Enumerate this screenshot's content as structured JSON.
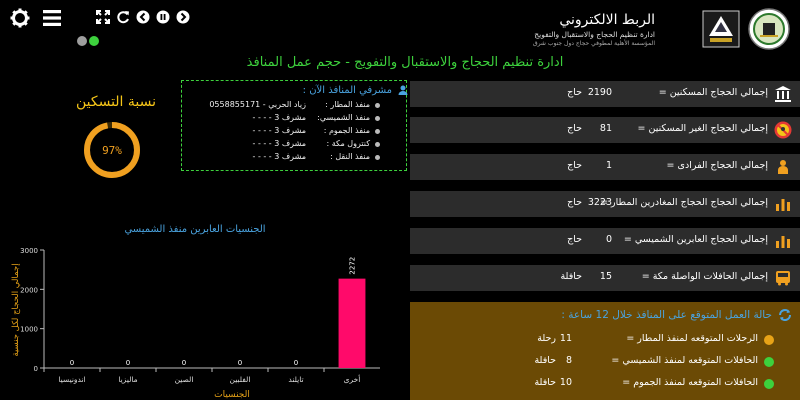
{
  "brand": {
    "title": "الربط الالكتروني",
    "subtitle": "ادارة تنظيم الحجاج والاستقبال والتفويج",
    "subtitle2": "المؤسسة الأهلية لمطوفي حجاج دول جنوب شرق"
  },
  "page_title": "ادارة تنظيم الحجاج والاستقبال والتفويج - حجم عمل المنافذ",
  "toolbar": {
    "icons": [
      "gear-icon",
      "menu-icon",
      "fullscreen-icon",
      "refresh-icon",
      "back-icon",
      "pause-icon",
      "forward-icon"
    ]
  },
  "status_dots": {
    "colors": [
      "#9e9e9e",
      "#3dd13d"
    ]
  },
  "occupancy": {
    "title": "نسبة التسكين",
    "value": "97%",
    "percent": 97,
    "color": "#f0a020"
  },
  "supervisors": {
    "title": "مشرفي المنافذ الآن :",
    "rows": [
      {
        "key": "منفذ المطار :",
        "value": "زياد الحربي - 0558855171"
      },
      {
        "key": "منفذ الشميسي:",
        "value": "مشرف 3 - - - -"
      },
      {
        "key": "منفذ الجموم :",
        "value": "مشرف 3 - - - -"
      },
      {
        "key": "كنترول مكة :",
        "value": "مشرف 3 - - - -"
      },
      {
        "key": "منفذ النقل :",
        "value": "مشرف 3 - - - -"
      }
    ]
  },
  "stats": [
    {
      "icon": "bank-icon",
      "label": "إجمالي الحجاج المسكنين =",
      "value": "2190",
      "unit": "حاج"
    },
    {
      "icon": "no-entry-icon",
      "label": "إجمالي الحجاج الغير المسكنين =",
      "value": "81",
      "unit": "حاج"
    },
    {
      "icon": "person-icon",
      "label": "إجمالي الحجاج الفرادى =",
      "value": "1",
      "unit": "حاج"
    },
    {
      "icon": "bar-chart-icon",
      "label": "إجمالي الحجاج الحجاج المغادرين المطار =",
      "value": "3223",
      "unit": "حاج"
    },
    {
      "icon": "bar-chart-icon",
      "label": "إجمالي الحجاج العابرين الشميسي =",
      "value": "0",
      "unit": "حاج"
    },
    {
      "icon": "bar-chart-icon",
      "label": "إجمالي الحافلات الواصلة مكة =",
      "value": "15",
      "unit": "حافلة"
    }
  ],
  "expected": {
    "title": "حالة العمل المتوقع على المنافذ خلال 12 ساعة :",
    "rows": [
      {
        "label": "الرحلات المتوقعه لمنفذ المطار =",
        "value": "11",
        "unit": "رحلة",
        "color": "#e8a317"
      },
      {
        "label": "الحافلات المتوقعه لمنفذ الشميسي =",
        "value": "8",
        "unit": "حافلة",
        "color": "#3dd13d"
      },
      {
        "label": "الحافلات المتوقعه لمنفذ الجموم =",
        "value": "10",
        "unit": "حافلة",
        "color": "#3dd13d"
      }
    ]
  },
  "chart_data": {
    "type": "bar",
    "title": "الجنسيات العابرين منفذ الشميسي",
    "xlabel": "الجنسيات",
    "ylabel": "إجمالي الحجاج لكل جنسية",
    "categories": [
      "اندونيسيا",
      "ماليزيا",
      "الصين",
      "الفلبين",
      "تايلند",
      "أخرى"
    ],
    "values": [
      0,
      0,
      0,
      0,
      0,
      2272
    ],
    "data_labels": [
      "0",
      "0",
      "0",
      "0",
      "0",
      "2272"
    ],
    "yticks": [
      0,
      1000,
      2000,
      3000
    ],
    "ylim": [
      0,
      3000
    ],
    "bar_color": "#ff0a6a",
    "grid": false,
    "legend": "none"
  }
}
